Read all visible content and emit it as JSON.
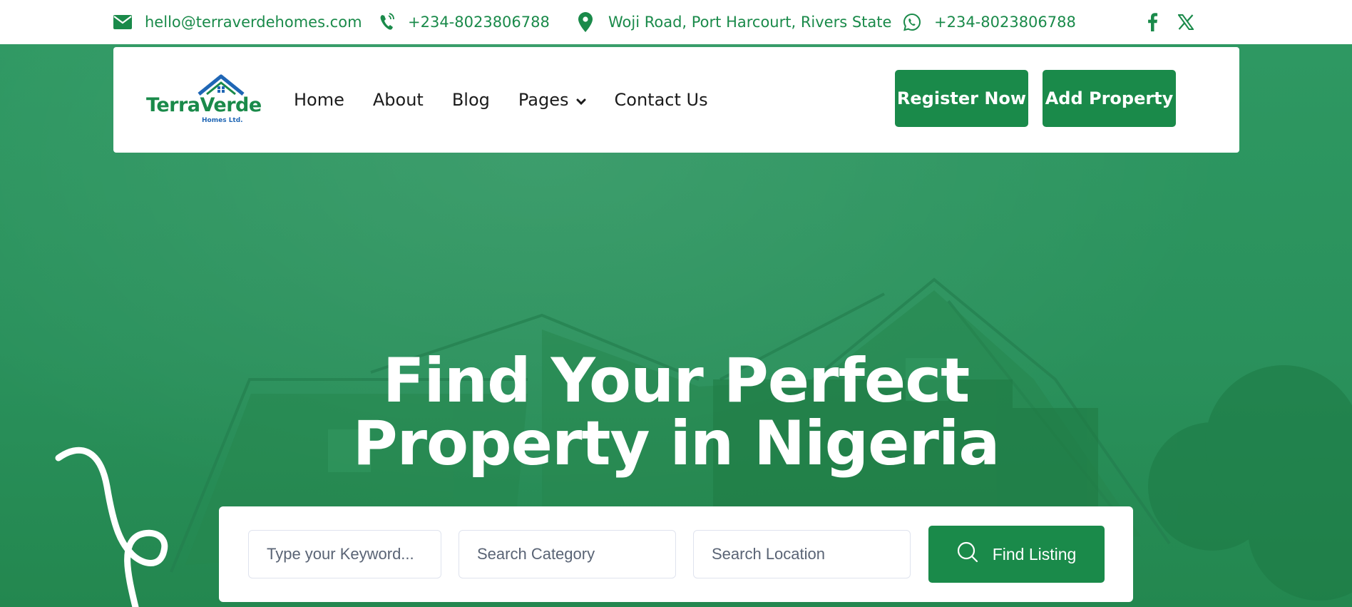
{
  "topbar": {
    "email": "hello@terraverdehomes.com",
    "phone": "+234-8023806788",
    "address": "Woji Road, Port Harcourt, Rivers State",
    "whatsapp": "+234-8023806788",
    "icons": [
      "envelope-icon",
      "phone-icon",
      "location-pin-icon",
      "whatsapp-icon",
      "facebook-icon",
      "x-icon"
    ]
  },
  "logo": {
    "brand": "TerraVerde",
    "sub": "Homes Ltd."
  },
  "nav": {
    "items": [
      "Home",
      "About",
      "Blog",
      "Pages",
      "Contact Us"
    ]
  },
  "actions": {
    "register": "Register Now",
    "add_property": "Add Property"
  },
  "hero": {
    "title_line1": "Find Your Perfect",
    "title_line2": "Property in Nigeria"
  },
  "search": {
    "keyword_placeholder": "Type your Keyword...",
    "category_placeholder": "Search Category",
    "location_placeholder": "Search Location",
    "button": "Find Listing"
  },
  "colors": {
    "brand_green": "#1a8a4a",
    "hero_green": "#2a9360",
    "logo_blue": "#1f66b5"
  }
}
